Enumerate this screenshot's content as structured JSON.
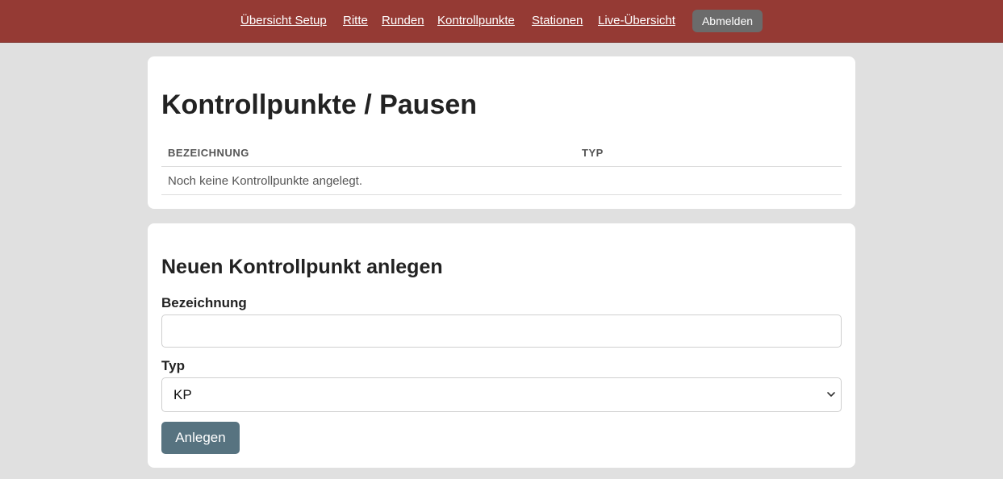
{
  "nav": {
    "links": [
      {
        "label": "Übersicht Setup"
      },
      {
        "label": "Ritte"
      },
      {
        "label": "Runden"
      },
      {
        "label": "Kontrollpunkte"
      },
      {
        "label": "Stationen"
      },
      {
        "label": "Live-Übersicht"
      }
    ],
    "logout_label": "Abmelden"
  },
  "list_card": {
    "title": "Kontrollpunkte / Pausen",
    "columns": [
      "BEZEICHNUNG",
      "TYP"
    ],
    "empty_message": "Noch keine Kontrollpunkte angelegt."
  },
  "form_card": {
    "title": "Neuen Kontrollpunkt anlegen",
    "name_label": "Bezeichnung",
    "name_value": "",
    "type_label": "Typ",
    "type_value": "KP",
    "submit_label": "Anlegen"
  },
  "colors": {
    "topbar": "#953a34",
    "logout_button": "#6b6b6b",
    "submit_button": "#577380",
    "page_background": "#e0e0e0"
  }
}
